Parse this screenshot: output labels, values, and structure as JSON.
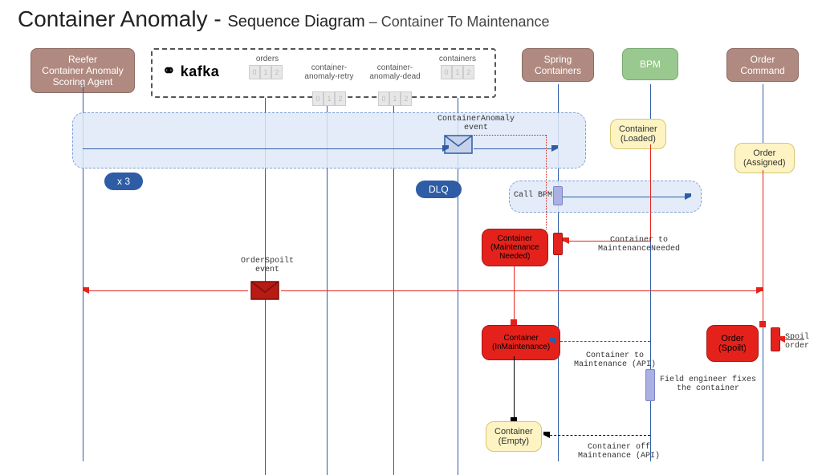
{
  "title": {
    "main": "Container Anomaly - ",
    "sub1": "Sequence Diagram",
    "sub2": " – Container To Maintenance"
  },
  "participants": {
    "reefer": "Reefer\nContainer Anomaly\nScoring Agent",
    "spring": "Spring\nContainers",
    "bpm": "BPM",
    "order": "Order\nCommand"
  },
  "kafka": {
    "logo": "kafka",
    "topics": {
      "orders": "orders",
      "retry": "container-\nanomaly-retry",
      "dead": "container-\nanomaly-dead",
      "containers": "containers"
    },
    "parts": [
      "0",
      "1",
      "2"
    ]
  },
  "badges": {
    "x3": "x 3",
    "dlq": "DLQ"
  },
  "events": {
    "anomaly": "ContainerAnomaly\nevent",
    "spoilt": "OrderSpoilt\nevent"
  },
  "states": {
    "loaded": "Container\n(Loaded)",
    "assigned": "Order\n(Assigned)",
    "maintNeeded": "Container\n(Maintenance\nNeeded)",
    "inMaint": "Container\n(InMaintenance)",
    "orderSpoilt": "Order\n(Spoilt)",
    "empty": "Container\n(Empty)"
  },
  "notes": {
    "callBpm": "Call BPM",
    "toMaintNeeded": "Container to\nMaintenanceNeeded",
    "toMaintApi": "Container to\nMaintenance (API)",
    "fieldEng": "Field engineer fixes\nthe container",
    "offMaint": "Container off\nMaintenance (API)",
    "spoilOrder": "Spoil\norder"
  },
  "colors": {
    "blue": "#2e5da6",
    "red": "#e4221b",
    "yellow": "#fdf3c3",
    "green": "#99c98e",
    "brown": "#b08a80"
  }
}
